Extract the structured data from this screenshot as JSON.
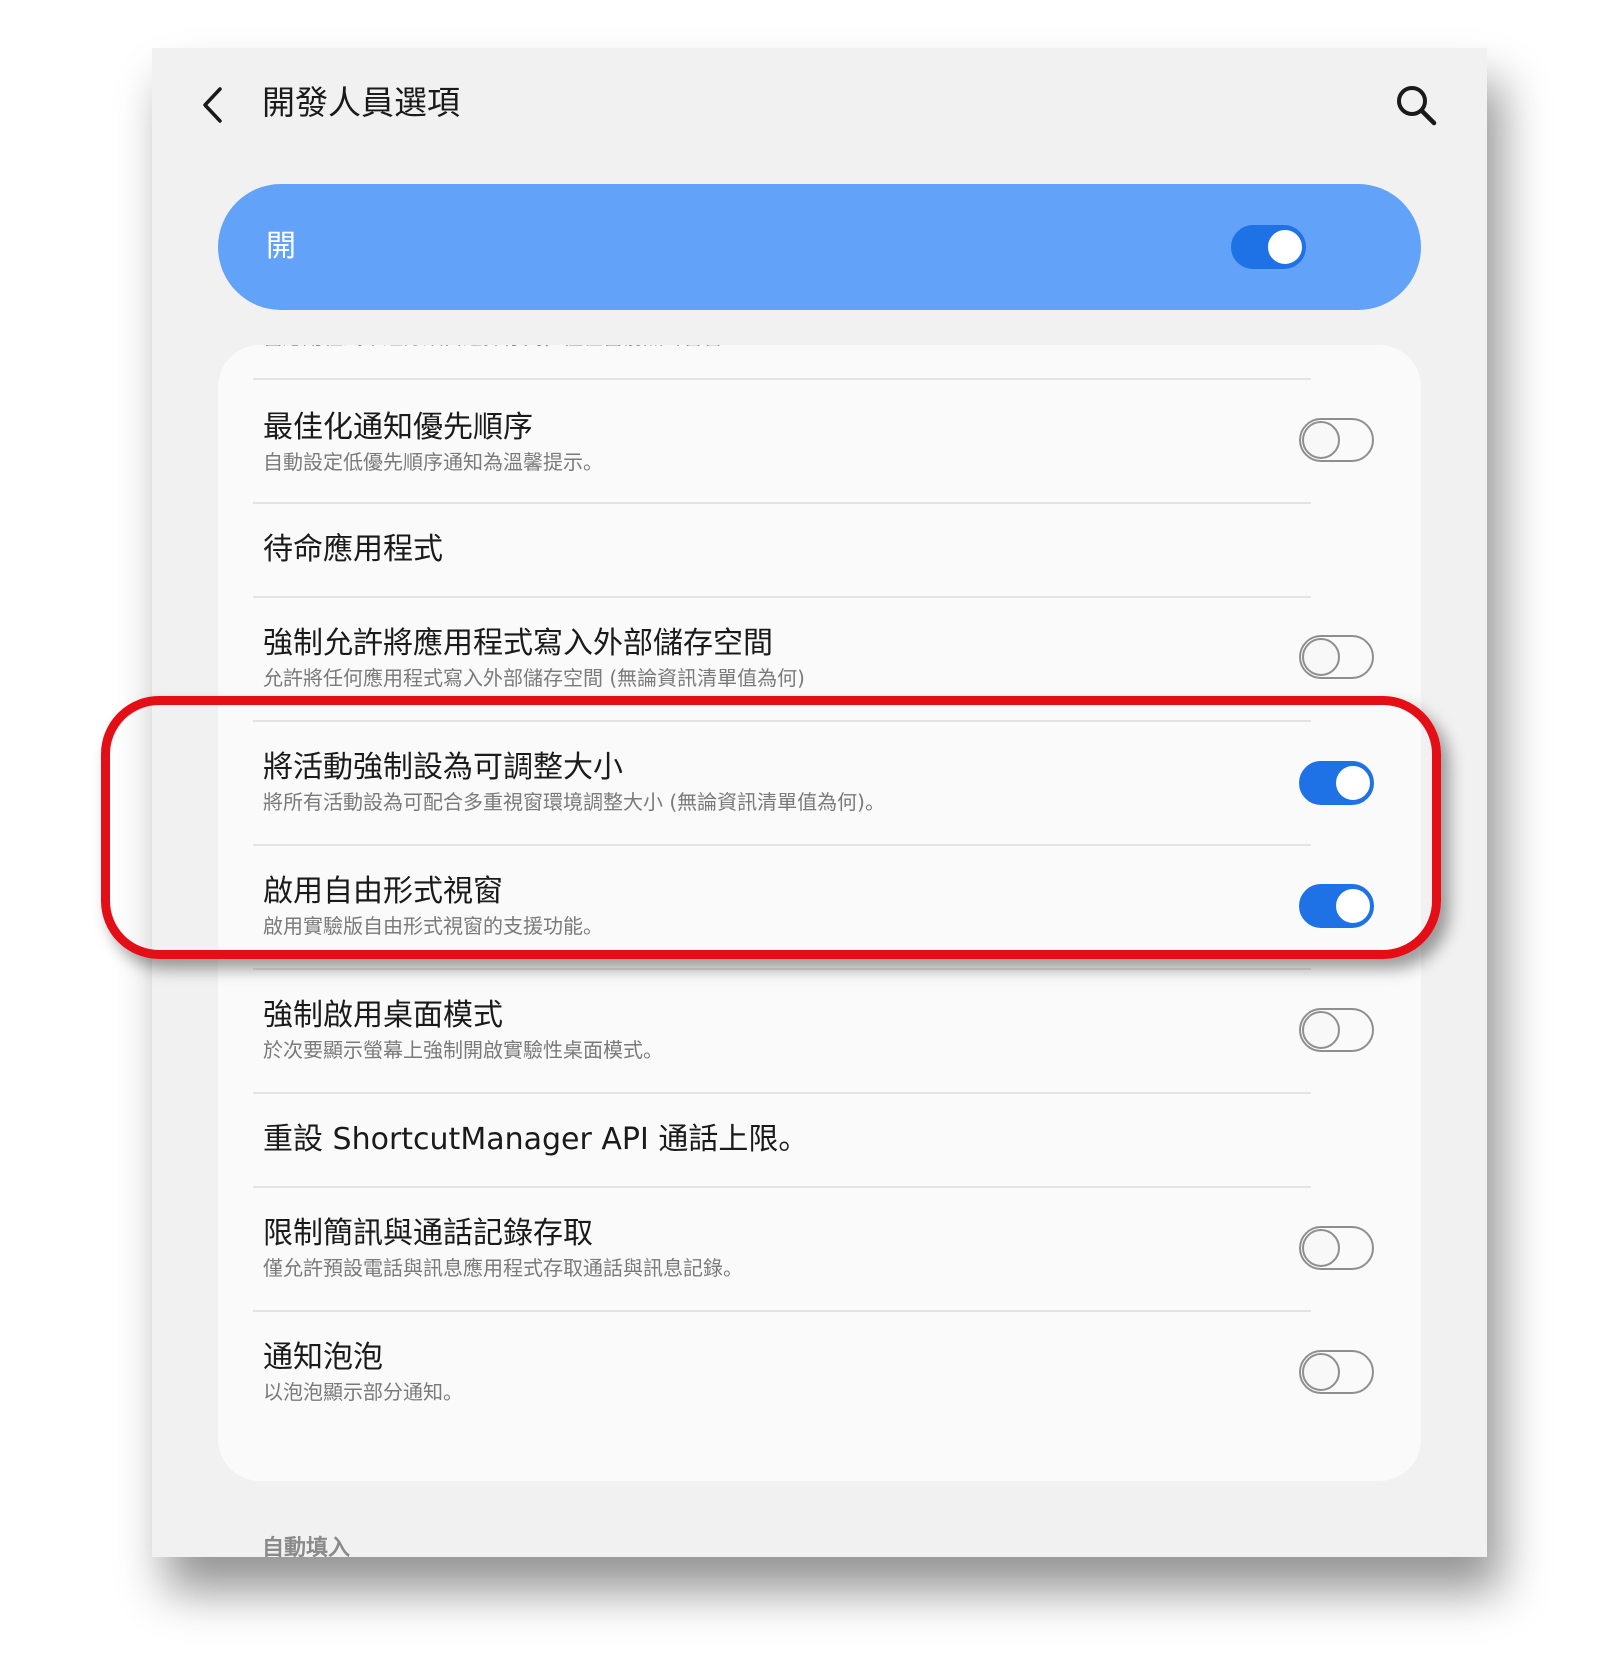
{
  "header": {
    "back_icon": "chevron-left-icon",
    "title": "開發人員選項",
    "search_icon": "search-icon"
  },
  "master_switch": {
    "label": "開",
    "state": "on",
    "accent_color": "#62a2f8"
  },
  "list": {
    "clipped_top_text": "當應用程式未經分類自選擇佇列，僅在當前無聲音音",
    "items": [
      {
        "title": "最佳化通知優先順序",
        "subtitle": "自動設定低優先順序通知為溫馨提示。",
        "toggle": "off"
      },
      {
        "title": "待命應用程式",
        "subtitle": "",
        "toggle": "none"
      },
      {
        "title": "強制允許將應用程式寫入外部儲存空間",
        "subtitle": "允許將任何應用程式寫入外部儲存空間 (無論資訊清單值為何)",
        "toggle": "off"
      },
      {
        "title": "將活動強制設為可調整大小",
        "subtitle": "將所有活動設為可配合多重視窗環境調整大小 (無論資訊清單值為何)。",
        "toggle": "on"
      },
      {
        "title": "啟用自由形式視窗",
        "subtitle": "啟用實驗版自由形式視窗的支援功能。",
        "toggle": "on"
      },
      {
        "title": "強制啟用桌面模式",
        "subtitle": "於次要顯示螢幕上強制開啟實驗性桌面模式。",
        "toggle": "off"
      },
      {
        "title": "重設 ShortcutManager API 通話上限。",
        "subtitle": "",
        "toggle": "none"
      },
      {
        "title": "限制簡訊與通話記錄存取",
        "subtitle": "僅允許預設電話與訊息應用程式存取通話與訊息記錄。",
        "toggle": "off"
      },
      {
        "title": "通知泡泡",
        "subtitle": "以泡泡顯示部分通知。",
        "toggle": "off"
      }
    ]
  },
  "next_section_header": "自動填入",
  "highlight": {
    "color": "#e40f16",
    "covers": [
      "將活動強制設為可調整大小",
      "啟用自由形式視窗"
    ]
  },
  "colors": {
    "switch_on": "#1f72e6",
    "switch_off_outline": "#8f8f8f"
  }
}
